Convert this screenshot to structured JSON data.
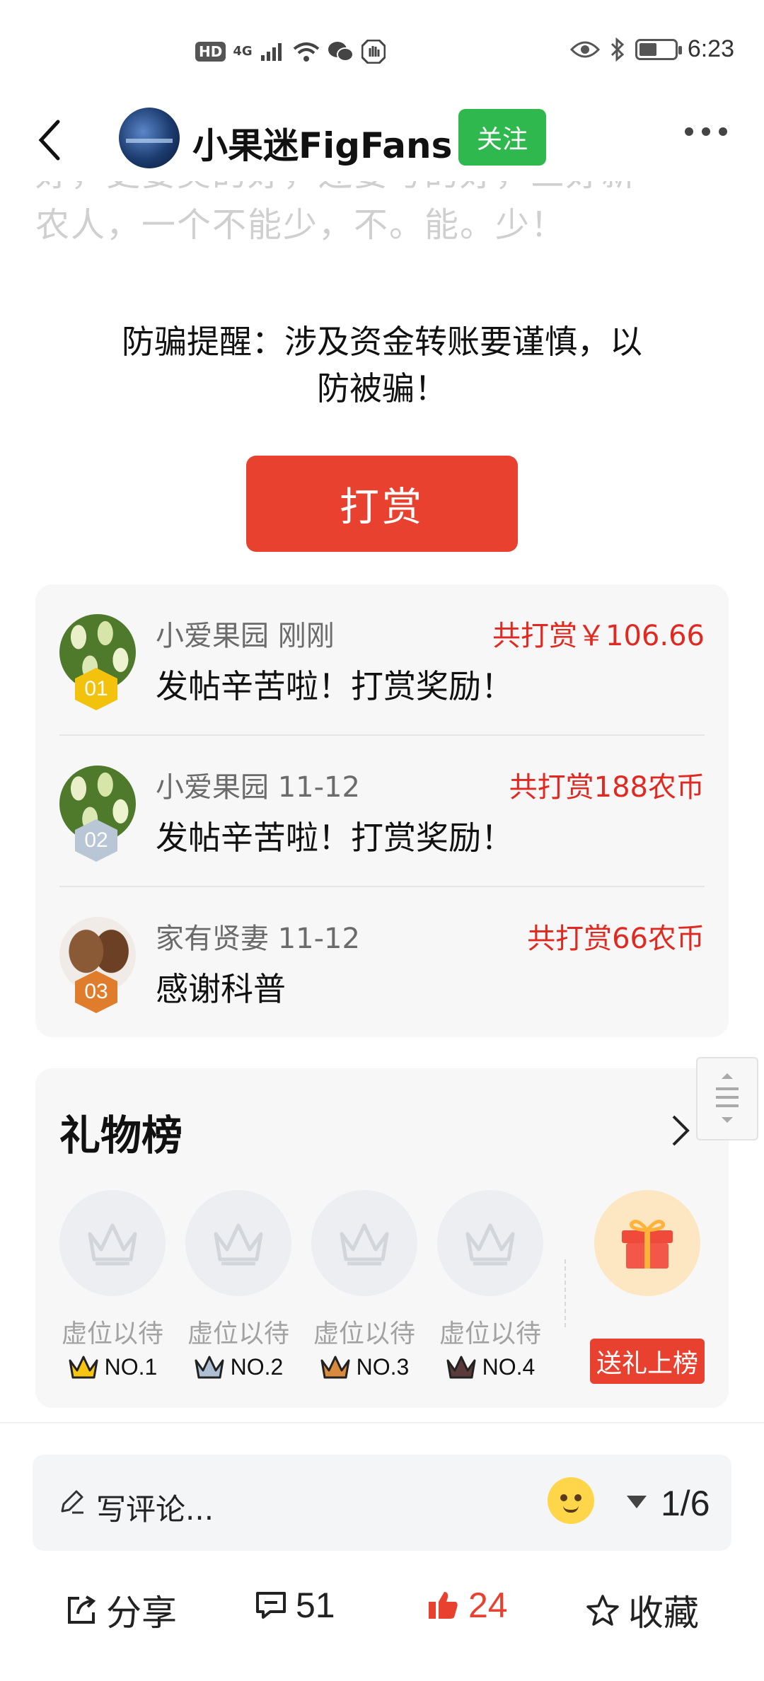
{
  "status_bar": {
    "hd": "HD",
    "network": "4G",
    "time": "6:23",
    "battery_level": 0.5
  },
  "header": {
    "author_name": "小果迷FigFans",
    "follow_label": "关注"
  },
  "article": {
    "faded_lines": [
      "好，更要奖的好，还要写的好，三好新",
      "农人，一个不能少，不。能。少！"
    ]
  },
  "warning": {
    "line1": "防骗提醒：涉及资金转账要谨慎，以",
    "line2": "防被骗！"
  },
  "tip_button": {
    "label": "打赏"
  },
  "tips": [
    {
      "rank": "01",
      "user": "小爱果园 刚刚",
      "amount": "共打赏￥106.66",
      "message": "发帖辛苦啦！打赏奖励！"
    },
    {
      "rank": "02",
      "user": "小爱果园 11-12",
      "amount": "共打赏188农币",
      "message": "发帖辛苦啦！打赏奖励！"
    },
    {
      "rank": "03",
      "user": "家有贤妻 11-12",
      "amount": "共打赏66农币",
      "message": "感谢科普"
    }
  ],
  "gift_board": {
    "title": "礼物榜",
    "slots": [
      {
        "label": "虚位以待",
        "rank": "NO.1"
      },
      {
        "label": "虚位以待",
        "rank": "NO.2"
      },
      {
        "label": "虚位以待",
        "rank": "NO.3"
      },
      {
        "label": "虚位以待",
        "rank": "NO.4"
      }
    ],
    "send_label": "送礼上榜"
  },
  "comment_bar": {
    "placeholder": "写评论...",
    "page": "1/6"
  },
  "actions": {
    "share": "分享",
    "comments": "51",
    "likes": "24",
    "favorite": "收藏"
  },
  "colors": {
    "accent_red": "#e8412f",
    "amount_red": "#e02a21",
    "follow_green": "#2fb84e",
    "rank_gold": "#f2c20c",
    "rank_silver": "#b9c6d6",
    "rank_bronze": "#e07d2c"
  }
}
